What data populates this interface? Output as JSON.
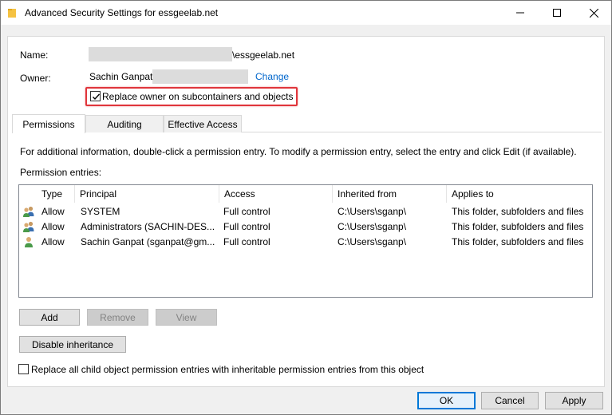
{
  "window": {
    "title": "Advanced Security Settings for essgeelab.net",
    "controls": [
      "minimize",
      "maximize",
      "close"
    ]
  },
  "object": {
    "name_label": "Name:",
    "name_value": "\\essgeelab.net",
    "owner_label": "Owner:",
    "owner_value": "Sachin Ganpat",
    "change_link": "Change",
    "replace_owner_label": "Replace owner on subcontainers and objects",
    "replace_owner_checked": true
  },
  "tabs": [
    {
      "label": "Permissions",
      "active": true
    },
    {
      "label": "Auditing",
      "active": false
    },
    {
      "label": "Effective Access",
      "active": false
    }
  ],
  "permissions": {
    "info_text": "For additional information, double-click a permission entry. To modify a permission entry, select the entry and click Edit (if available).",
    "entries_label": "Permission entries:",
    "columns": [
      "Type",
      "Principal",
      "Access",
      "Inherited from",
      "Applies to"
    ],
    "rows": [
      {
        "icon": "group-users-icon",
        "type": "Allow",
        "principal": "SYSTEM",
        "access": "Full control",
        "inherited_from": "C:\\Users\\sganp\\",
        "applies_to": "This folder, subfolders and files"
      },
      {
        "icon": "group-users-icon",
        "type": "Allow",
        "principal": "Administrators (SACHIN-DES...",
        "access": "Full control",
        "inherited_from": "C:\\Users\\sganp\\",
        "applies_to": "This folder, subfolders and files"
      },
      {
        "icon": "user-icon",
        "type": "Allow",
        "principal": "Sachin Ganpat (sganpat@gm...",
        "access": "Full control",
        "inherited_from": "C:\\Users\\sganp\\",
        "applies_to": "This folder, subfolders and files"
      }
    ],
    "buttons": {
      "add": "Add",
      "remove": "Remove",
      "view": "View",
      "disable_inheritance": "Disable inheritance"
    },
    "replace_child_label": "Replace all child object permission entries with inheritable permission entries from this object",
    "replace_child_checked": false
  },
  "footer": {
    "ok": "OK",
    "cancel": "Cancel",
    "apply": "Apply"
  },
  "colors": {
    "highlight": "#e0353b",
    "link": "#0066cc",
    "default_button_border": "#0078d7"
  }
}
